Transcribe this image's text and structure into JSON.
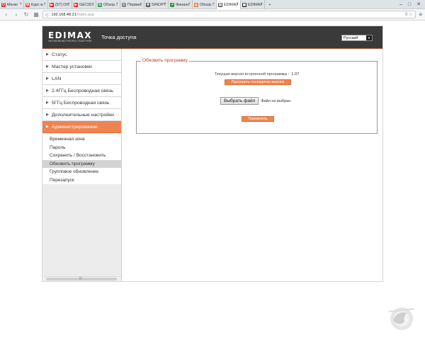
{
  "browser": {
    "tabs": [
      {
        "label": "Меню",
        "icon_color": "#d9322c",
        "icon_char": "O"
      },
      {
        "label": "Курс в...",
        "icon_color": "#e84a3b",
        "icon_char": "M"
      },
      {
        "label": "(57) Об...",
        "icon_color": "#e62117",
        "icon_char": "▶"
      },
      {
        "label": "GECID.c...",
        "icon_color": "#e62117",
        "icon_char": "▶"
      },
      {
        "label": "Обзор...",
        "icon_color": "#2ea44f",
        "icon_char": "G"
      },
      {
        "label": "Первая...",
        "icon_color": "#888888",
        "icon_char": "≡"
      },
      {
        "label": "SINOPTI...",
        "icon_color": "#555555",
        "icon_char": "❄"
      },
      {
        "label": "Финанс...",
        "icon_color": "#2d8f3c",
        "icon_char": "↗"
      },
      {
        "label": "Обзор...",
        "icon_color": "#e8752a",
        "icon_char": "◎"
      },
      {
        "label": "EDIMAX",
        "icon_color": "#444444",
        "icon_char": "▤"
      },
      {
        "label": "EDIMAX",
        "icon_color": "#222222",
        "icon_char": "▣"
      }
    ],
    "url_host": "192.168.48.21",
    "url_path": "/index.asp",
    "addr_right_icons": "0 ☆"
  },
  "router": {
    "logo_mark": "EDIMAX",
    "logo_tagline": "NETWORKING PEOPLE TOGETHER",
    "page_title": "Точка доступа",
    "language": "Русский",
    "menu": [
      {
        "label": "Статус"
      },
      {
        "label": "Мастер установки"
      },
      {
        "label": "LAN"
      },
      {
        "label": "2.4ГГц Беспроводная связь"
      },
      {
        "label": "5ГГц Беспроводная связь"
      },
      {
        "label": "Дополнительные настройки"
      },
      {
        "label": "Администрирование"
      }
    ],
    "submenu": [
      {
        "label": "Временная зона"
      },
      {
        "label": "Пароль"
      },
      {
        "label": "Сохранить / Восстановить"
      },
      {
        "label": "Обновить программу"
      },
      {
        "label": "Групповое обновление"
      },
      {
        "label": "Перезапуск"
      }
    ],
    "active_menu_index": 6,
    "active_submenu_index": 3,
    "firmware": {
      "legend": "Обновить программу",
      "current_version_label": "Текущая версия встроенной программы :",
      "current_version": "1.07",
      "check_button": "Проверить последнюю версию",
      "choose_file_button": "Выбрать файл",
      "file_status": "Файл не выбран",
      "apply_button": "Применить"
    }
  },
  "colors": {
    "accent": "#f08350",
    "header_bg": "#3a3a3a",
    "legend_red": "#c0392b"
  }
}
